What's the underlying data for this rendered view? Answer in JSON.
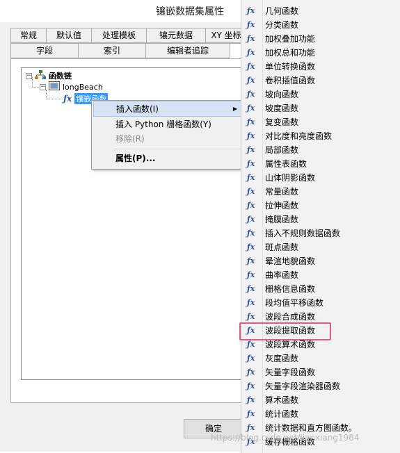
{
  "window": {
    "title": "镶嵌数据集属性"
  },
  "tabs": {
    "row1": [
      "常规",
      "默认值",
      "处理模板",
      "镶元数据",
      "XY 坐标"
    ],
    "row2": [
      "字段",
      "索引",
      "编辑者追踪",
      ""
    ]
  },
  "tree": {
    "root": "函数链",
    "child": "longBeach",
    "grandchild": "镶嵌函数"
  },
  "context_menu": {
    "items": [
      {
        "label": "插入函数(I)",
        "has_submenu": true,
        "state": "hover"
      },
      {
        "label": "插入 Python 栅格函数(Y)",
        "state": "normal"
      },
      {
        "label": "移除(R)",
        "state": "disabled"
      },
      {
        "label": "属性(P)...",
        "state": "normal",
        "bold": true
      }
    ]
  },
  "buttons": {
    "ok": "确定"
  },
  "submenu": {
    "items": [
      "几何函数",
      "分类函数",
      "加权叠加功能",
      "加权总和功能",
      "单位转换函数",
      "卷积插值函数",
      "坡向函数",
      "坡度函数",
      "复变函数",
      "对比度和亮度函数",
      "局部函数",
      "属性表函数",
      "山体阴影函数",
      "常量函数",
      "拉伸函数",
      "掩膜函数",
      "插入不规则数据函数",
      "斑点函数",
      "晕渲地貌函数",
      "曲率函数",
      "栅格信息函数",
      "段均值平移函数",
      "波段合成函数",
      "波段提取函数",
      "波段算术函数",
      "灰度函数",
      "矢量字段函数",
      "矢量字段渲染器函数",
      "算术函数",
      "统计函数",
      "统计数据和直方图函数。",
      "缓存栅格函数"
    ],
    "highlighted": "波段提取函数"
  },
  "watermark": "https://blog.csdn.net/lianxiang1984",
  "colors": {
    "highlight": "#e05a8b",
    "selection": "#3399ff",
    "menu_hover": "#d5e3f5"
  }
}
